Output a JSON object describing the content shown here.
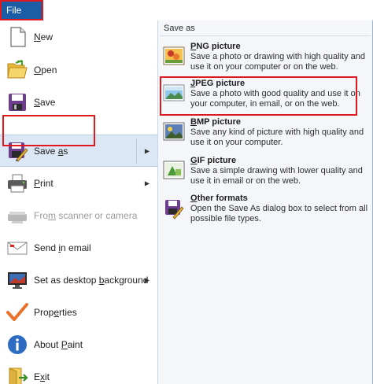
{
  "file_tab": {
    "label": "File"
  },
  "menu": {
    "items": [
      {
        "label": "New",
        "icon": "new-document-icon",
        "mnemonic_index": 0
      },
      {
        "label": "Open",
        "icon": "open-folder-icon",
        "mnemonic_index": 0
      },
      {
        "label": "Save",
        "icon": "floppy-disk-icon",
        "mnemonic_index": 0
      },
      {
        "label": "Save as",
        "icon": "save-as-icon",
        "mnemonic_index": 5,
        "has_submenu": true,
        "selected": true
      },
      {
        "label": "Print",
        "icon": "printer-icon",
        "mnemonic_index": 0,
        "has_submenu": true
      },
      {
        "label": "From scanner or camera",
        "icon": "scanner-icon",
        "mnemonic_index": 3,
        "disabled": true
      },
      {
        "label": "Send in email",
        "icon": "email-icon",
        "mnemonic_index": 5
      },
      {
        "label": "Set as desktop background",
        "icon": "desktop-background-icon",
        "mnemonic_index": 15,
        "has_submenu": true
      },
      {
        "label": "Properties",
        "icon": "checkmark-icon",
        "mnemonic_index": 4
      },
      {
        "label": "About Paint",
        "icon": "info-icon",
        "mnemonic_index": 6
      },
      {
        "label": "Exit",
        "icon": "exit-icon",
        "mnemonic_index": 1
      }
    ]
  },
  "submenu": {
    "title": "Save as",
    "options": [
      {
        "title": "PNG picture",
        "desc": "Save a photo or drawing with high quality and use it on your computer or on the web.",
        "icon": "png-picture-icon",
        "mnemonic_index": 0
      },
      {
        "title": "JPEG picture",
        "desc": "Save a photo with good quality and use it on your computer, in email, or on the web.",
        "icon": "jpeg-picture-icon",
        "mnemonic_index": 0,
        "highlighted": true
      },
      {
        "title": "BMP picture",
        "desc": "Save any kind of picture with high quality and use it on your computer.",
        "icon": "bmp-picture-icon",
        "mnemonic_index": 0
      },
      {
        "title": "GIF picture",
        "desc": "Save a simple drawing with lower quality and use it in email or on the web.",
        "icon": "gif-picture-icon",
        "mnemonic_index": 0
      },
      {
        "title": "Other formats",
        "desc": "Open the Save As dialog box to select from all possible file types.",
        "icon": "other-formats-icon",
        "mnemonic_index": 0
      }
    ]
  },
  "colors": {
    "file_tab": "#1b5ea6",
    "highlight_border": "#e1191e",
    "selected_item": "#dbe7f5",
    "submenu_background": "#f4f6f9"
  }
}
